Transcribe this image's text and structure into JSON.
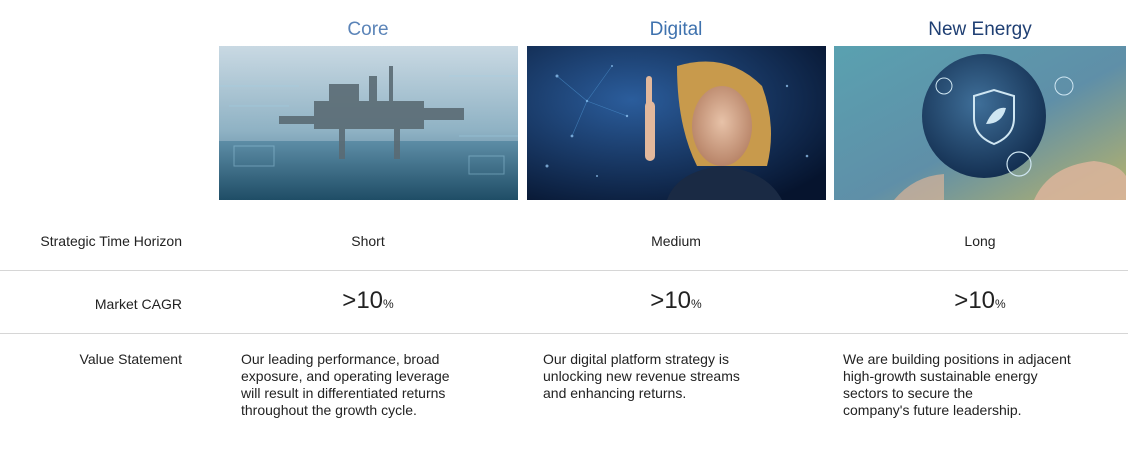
{
  "columns": [
    {
      "title": "Core",
      "color": "#5b84b8",
      "time_horizon": "Short",
      "cagr_value": ">10",
      "cagr_unit": "%",
      "value_statement": [
        "Our leading performance, broad",
        "exposure, and operating leverage",
        "will result in differentiated returns",
        "throughout the growth cycle."
      ]
    },
    {
      "title": "Digital",
      "color": "#3f72ae",
      "time_horizon": "Medium",
      "cagr_value": ">10",
      "cagr_unit": "%",
      "value_statement": [
        "Our digital platform strategy is",
        "unlocking new revenue streams",
        "and enhancing returns."
      ]
    },
    {
      "title": "New Energy",
      "color": "#1f3f73",
      "time_horizon": "Long",
      "cagr_value": ">10",
      "cagr_unit": "%",
      "value_statement": [
        "We are building positions in adjacent",
        "high-growth sustainable energy",
        "sectors to secure the",
        "company's future leadership."
      ]
    }
  ],
  "rows": {
    "time_horizon_label": "Strategic Time Horizon",
    "cagr_label": "Market CAGR",
    "value_statement_label": "Value Statement"
  },
  "images": [
    "offshore-oil-platform",
    "woman-touching-digital-network",
    "hands-holding-green-energy-globe"
  ]
}
